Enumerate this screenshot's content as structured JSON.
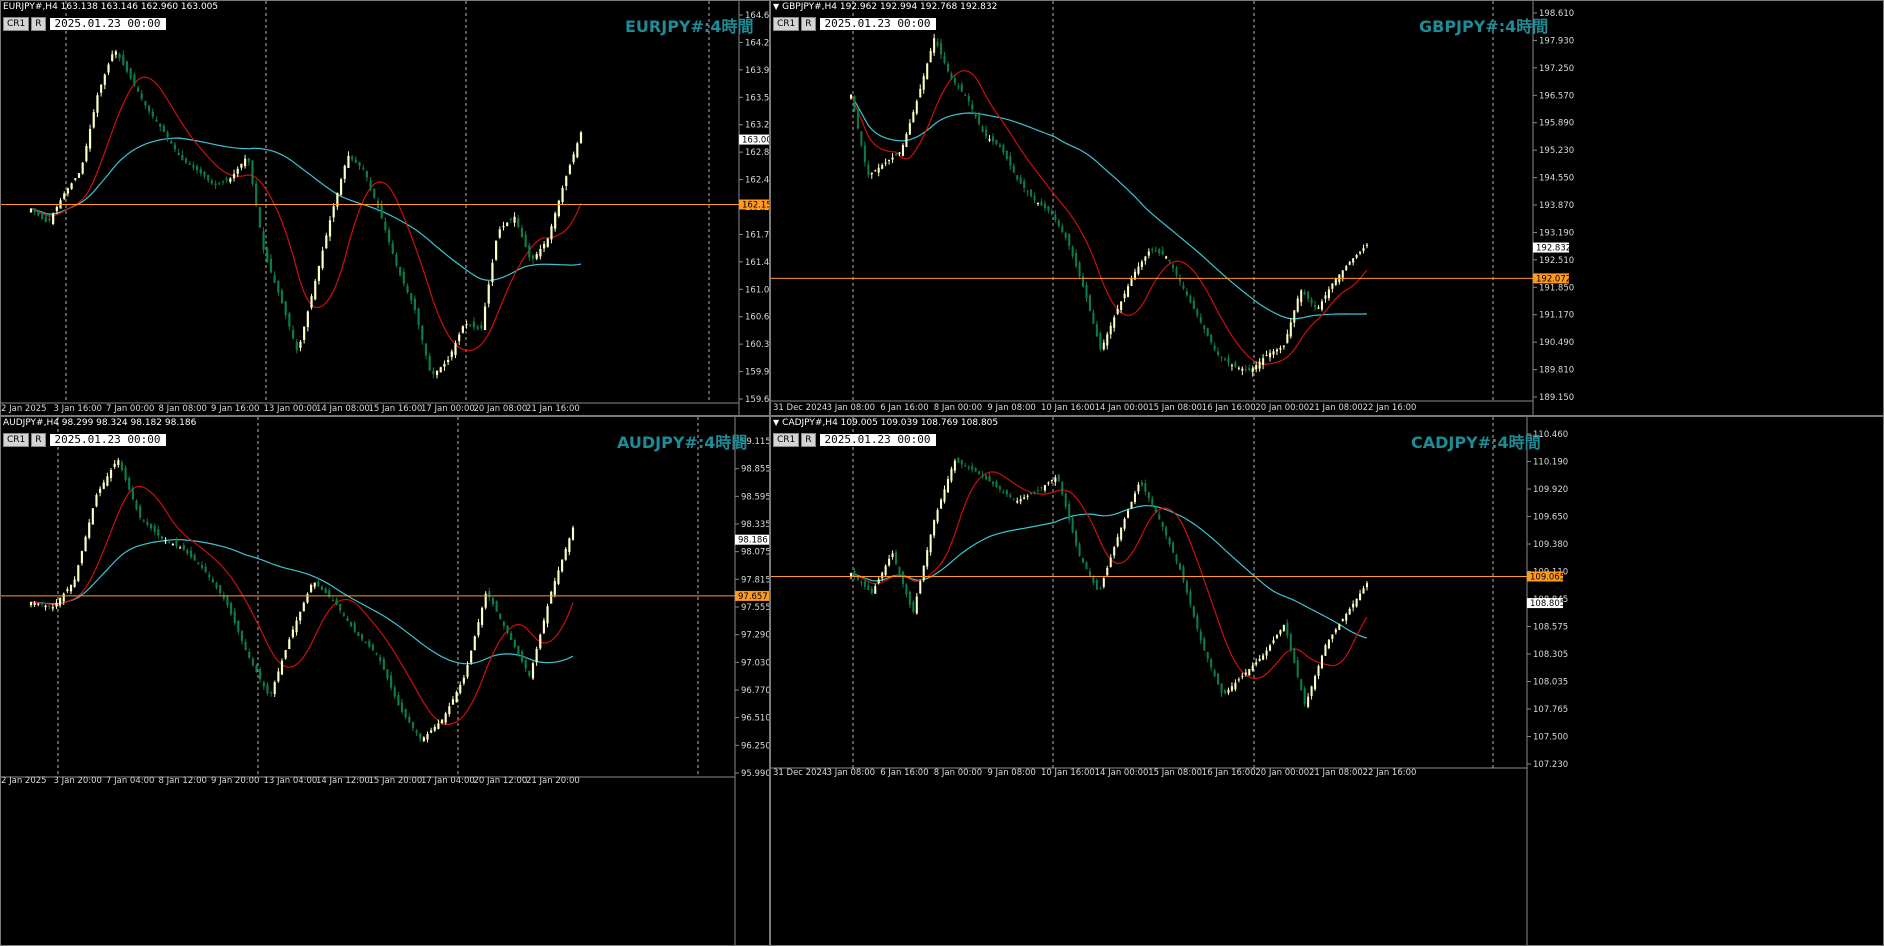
{
  "colors": {
    "background": "#000000",
    "bull": "#fdfdc6",
    "bear": "#0c7d4a",
    "ma_red": "#cc1010",
    "ma_cyan": "#3ec4d0",
    "hline": "#ff9a1e",
    "title": "#1e8c96",
    "axis_text": "#d9d9d9",
    "grid": "#cfcfcf"
  },
  "chart_data": [
    {
      "type": "candlestick",
      "symbol_info": "EURJPY#,H4  163.138 163.146 162.960 163.005",
      "title": "EURJPY#:4時間",
      "date_label": "2025.01.23 00:00",
      "buttons": [
        "CR1",
        "R"
      ],
      "ylim": [
        159.6,
        164.64
      ],
      "y_ticks": [
        "164.640",
        "164.280",
        "163.920",
        "163.560",
        "163.200",
        "162.840",
        "162.480",
        "162.120",
        "161.760",
        "161.400",
        "161.040",
        "160.680",
        "160.320",
        "159.960",
        "159.600"
      ],
      "x_ticks": [
        "2 Jan 2025",
        "3 Jan 16:00",
        "7 Jan 00:00",
        "8 Jan 08:00",
        "9 Jan 16:00",
        "13 Jan 00:00",
        "14 Jan 08:00",
        "15 Jan 16:00",
        "17 Jan 00:00",
        "20 Jan 08:00",
        "21 Jan 16:00"
      ],
      "hline": {
        "value": 162.153,
        "label": "162.153"
      },
      "current": {
        "value": 163.005,
        "label": "163.005"
      },
      "anchors": [
        162.1,
        161.9,
        162.3,
        162.6,
        163.6,
        164.2,
        163.8,
        163.4,
        163.1,
        162.75,
        162.6,
        162.4,
        162.5,
        162.8,
        161.5,
        160.9,
        160.2,
        161.1,
        162.0,
        162.8,
        162.6,
        162.0,
        161.3,
        160.8,
        159.9,
        160.1,
        160.6,
        160.5,
        161.8,
        162.0,
        161.4,
        161.7,
        162.45,
        163.1
      ]
    },
    {
      "type": "candlestick",
      "symbol_info": "GBPJPY#,H4  192.962 192.994 192.768 192.832",
      "title": "GBPJPY#:4時間",
      "date_label": "2025.01.23 00:00",
      "buttons": [
        "CR1",
        "R"
      ],
      "ylim": [
        189.15,
        198.61
      ],
      "y_ticks": [
        "198.610",
        "197.930",
        "197.250",
        "196.570",
        "195.890",
        "195.230",
        "194.550",
        "193.870",
        "193.190",
        "192.510",
        "191.850",
        "191.170",
        "190.490",
        "189.810",
        "189.150"
      ],
      "x_ticks": [
        "31 Dec 2024",
        "3 Jan 08:00",
        "6 Jan 16:00",
        "8 Jan 00:00",
        "9 Jan 08:00",
        "10 Jan 16:00",
        "14 Jan 00:00",
        "15 Jan 08:00",
        "16 Jan 16:00",
        "20 Jan 00:00",
        "21 Jan 08:00",
        "22 Jan 16:00"
      ],
      "hline": {
        "value": 192.072,
        "label": "192.072"
      },
      "current": {
        "value": 192.832,
        "label": "192.832"
      },
      "anchors": [
        196.6,
        194.6,
        194.9,
        195.2,
        196.5,
        198.0,
        197.0,
        196.5,
        195.6,
        195.3,
        194.5,
        194.0,
        193.7,
        193.0,
        191.8,
        190.3,
        191.3,
        192.2,
        192.8,
        192.6,
        191.8,
        191.0,
        190.2,
        189.9,
        189.8,
        190.2,
        190.4,
        191.8,
        191.3,
        192.0,
        192.5,
        192.9
      ]
    },
    {
      "type": "candlestick",
      "symbol_info": "AUDJPY#,H4  98.299 98.324 98.182 98.186",
      "title": "AUDJPY#:4時間",
      "date_label": "2025.01.23 00:00",
      "buttons": [
        "CR1",
        "R"
      ],
      "ylim": [
        95.99,
        99.115
      ],
      "y_ticks": [
        "99.115",
        "98.855",
        "98.595",
        "98.335",
        "98.075",
        "97.815",
        "97.555",
        "97.290",
        "97.030",
        "96.770",
        "96.510",
        "96.250",
        "95.990"
      ],
      "x_ticks": [
        "2 Jan 2025",
        "3 Jan 20:00",
        "7 Jan 04:00",
        "8 Jan 12:00",
        "9 Jan 20:00",
        "13 Jan 04:00",
        "14 Jan 12:00",
        "15 Jan 20:00",
        "17 Jan 04:00",
        "20 Jan 12:00",
        "21 Jan 20:00"
      ],
      "hline": {
        "value": 97.657,
        "label": "97.657"
      },
      "current": {
        "value": 98.186,
        "label": "98.186"
      },
      "anchors": [
        97.6,
        97.55,
        97.8,
        98.6,
        98.95,
        98.4,
        98.2,
        98.1,
        97.9,
        97.6,
        97.1,
        96.7,
        97.3,
        97.8,
        97.6,
        97.3,
        97.1,
        96.6,
        96.3,
        96.5,
        96.9,
        97.7,
        97.3,
        96.9,
        97.7,
        98.3
      ]
    },
    {
      "type": "candlestick",
      "symbol_info": "CADJPY#,H4  109.005 109.039 108.769 108.805",
      "title": "CADJPY#:4時間",
      "date_label": "2025.01.23 00:00",
      "buttons": [
        "CR1",
        "R"
      ],
      "ylim": [
        107.23,
        110.46
      ],
      "y_ticks": [
        "110.460",
        "110.190",
        "109.920",
        "109.650",
        "109.380",
        "109.110",
        "108.845",
        "108.575",
        "108.305",
        "108.035",
        "107.765",
        "107.500",
        "107.230"
      ],
      "x_ticks": [
        "31 Dec 2024",
        "3 Jan 08:00",
        "6 Jan 16:00",
        "8 Jan 00:00",
        "9 Jan 08:00",
        "10 Jan 16:00",
        "14 Jan 00:00",
        "15 Jan 08:00",
        "16 Jan 16:00",
        "20 Jan 00:00",
        "21 Jan 08:00",
        "22 Jan 16:00"
      ],
      "hline": {
        "value": 109.065,
        "label": "109.065"
      },
      "current": {
        "value": 108.805,
        "label": "108.805"
      },
      "anchors": [
        109.1,
        108.9,
        109.3,
        108.7,
        109.6,
        110.2,
        110.1,
        109.95,
        109.8,
        109.9,
        110.05,
        109.3,
        108.9,
        109.5,
        110.0,
        109.6,
        109.1,
        108.4,
        107.9,
        108.1,
        108.3,
        108.6,
        107.8,
        108.4,
        108.7,
        109.0
      ]
    }
  ]
}
